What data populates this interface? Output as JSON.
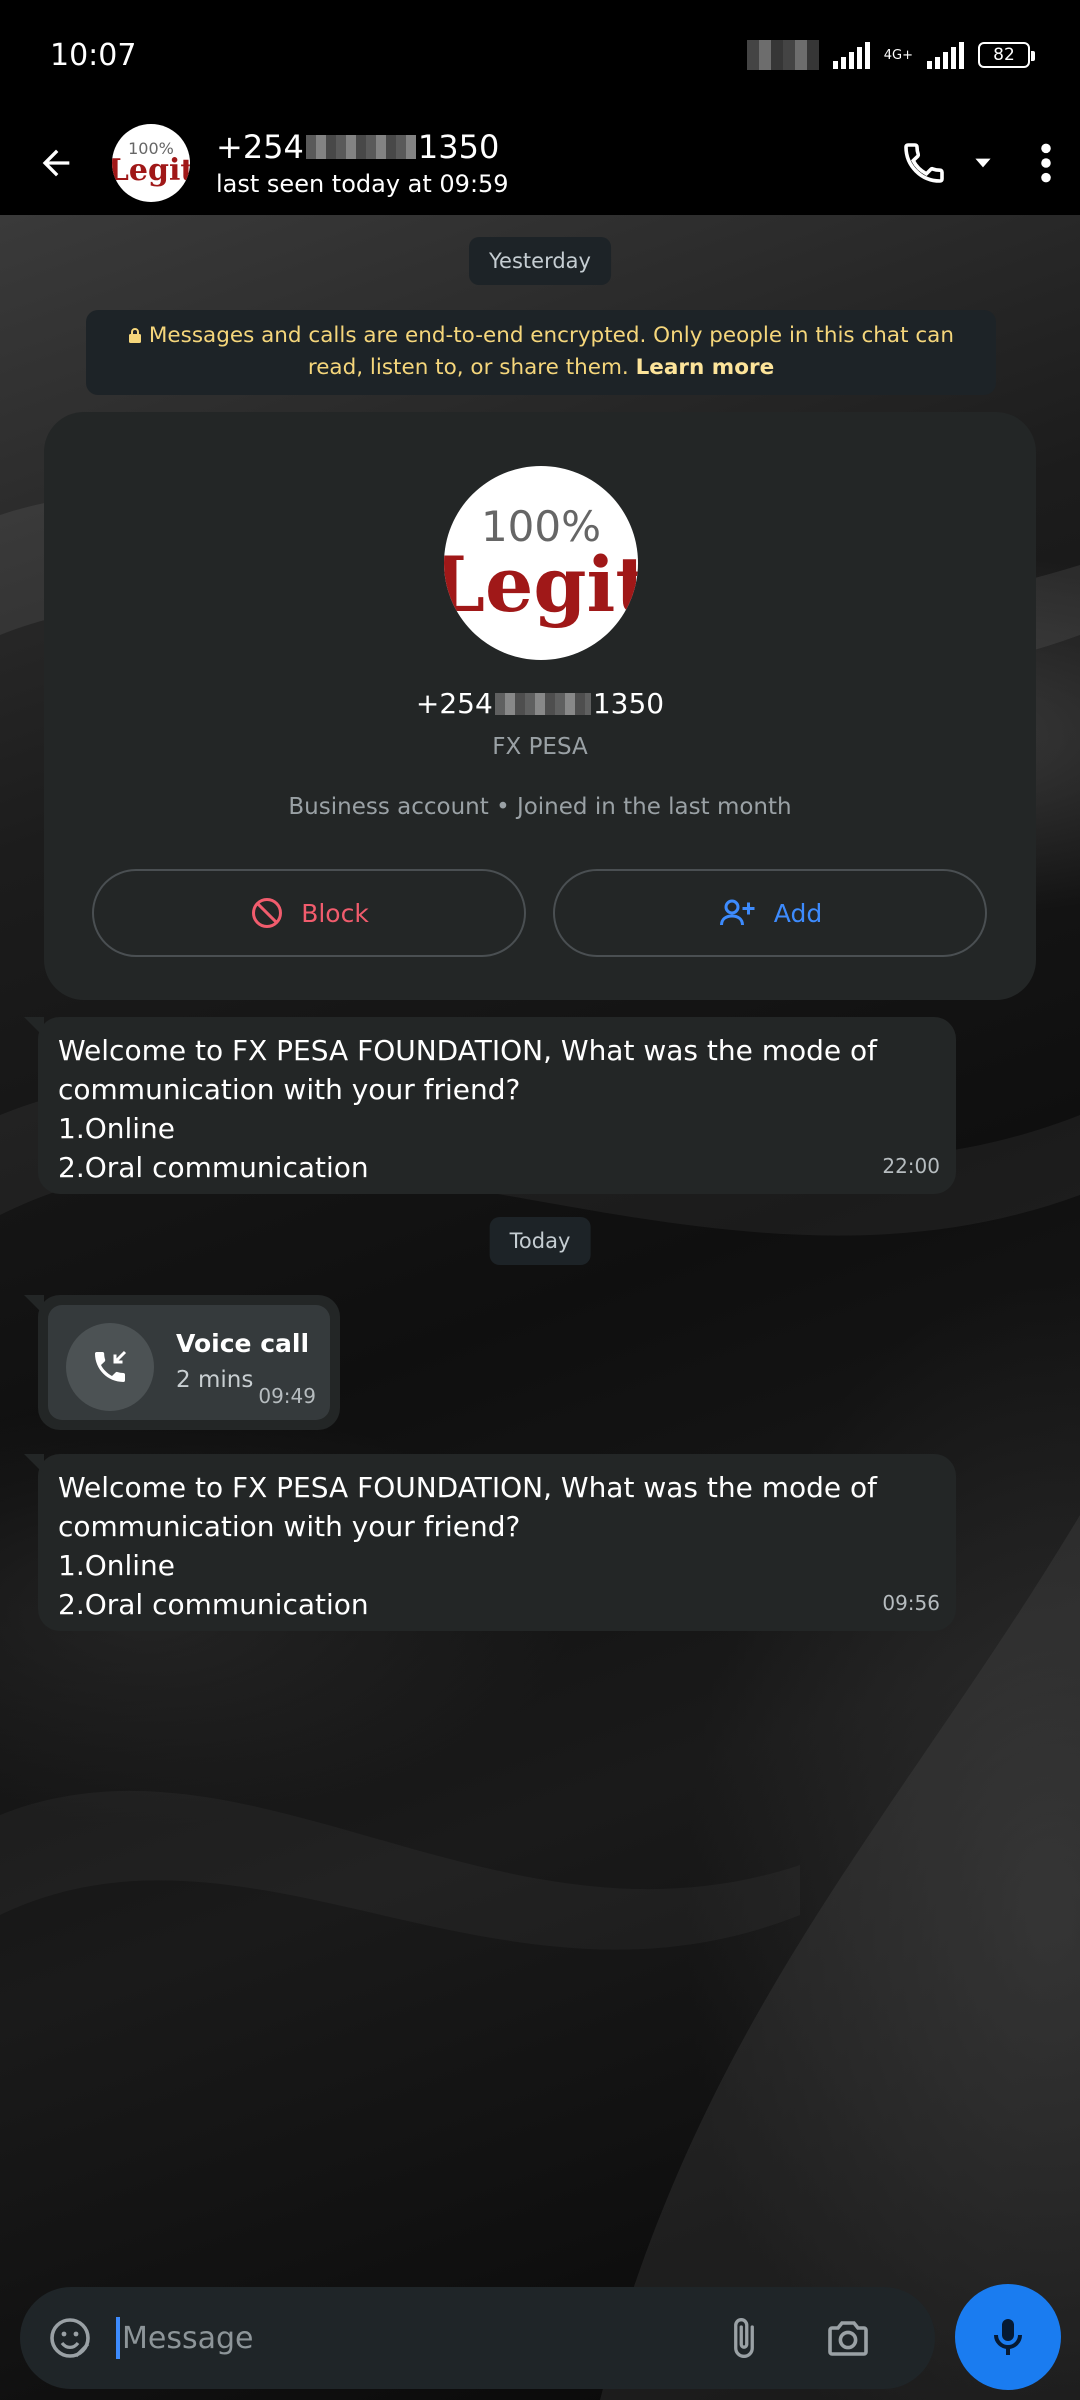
{
  "status_bar": {
    "time": "10:07",
    "network": "4G+",
    "battery": "82"
  },
  "header": {
    "phone_prefix": "+254",
    "phone_suffix": "1350",
    "last_seen": "last seen today at 09:59",
    "avatar_top": "100%",
    "avatar_bottom": "Legit"
  },
  "chat": {
    "date_yesterday": "Yesterday",
    "encryption_text": "Messages and calls are end-to-end encrypted. Only people in this chat can read, listen to, or share them.",
    "encryption_link": "Learn more",
    "profile": {
      "avatar_top": "100%",
      "avatar_bottom": "Legit",
      "phone_prefix": "+254",
      "phone_suffix": "1350",
      "business_name": "FX PESA",
      "meta": "Business account • Joined in the last month",
      "block_label": "Block",
      "add_label": "Add"
    },
    "message1": {
      "lines": [
        "Welcome to FX PESA FOUNDATION, What was the mode of",
        "communication with your friend?",
        "1.Online",
        "2.Oral communication"
      ],
      "time": "22:00"
    },
    "date_today": "Today",
    "voice_call": {
      "title": "Voice call",
      "duration": "2 mins",
      "time": "09:49"
    },
    "message2": {
      "lines": [
        "Welcome to FX PESA FOUNDATION, What was the mode of",
        "communication with your friend?",
        "1.Online",
        "2.Oral communication"
      ],
      "time": "09:56"
    }
  },
  "input": {
    "placeholder": "Message"
  },
  "colors": {
    "accent_blue": "#1a7cf0",
    "block_red": "#f15c6d",
    "encryption_yellow": "#f5d67b",
    "bubble": "#232626"
  }
}
